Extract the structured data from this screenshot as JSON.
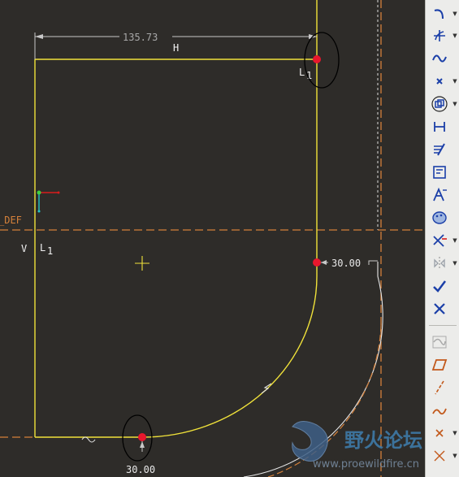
{
  "sketch": {
    "dimension_top": "135.73",
    "dimension_right": "30.00",
    "dimension_bottom": "30.00",
    "constraint_h": "H",
    "constraint_v": "V",
    "constraint_l1_top": "L",
    "constraint_l1_top_sub": "1",
    "constraint_l1_left": "L",
    "constraint_l1_left_sub": "1",
    "datum_label": "_DEF"
  },
  "colors": {
    "background": "#2e2c29",
    "sketch_line": "#f0e23a",
    "datum_line": "#d4803a",
    "dimension": "#c8c8c8",
    "point": "#e8172d",
    "toolbar_bg": "#ececea",
    "toolbar_icon": "#1b3fa8"
  },
  "toolbar": {
    "tools": [
      {
        "icon": "arc-icon",
        "has_menu": true
      },
      {
        "icon": "fillet-icon",
        "has_menu": true
      },
      {
        "icon": "spline-icon",
        "has_menu": false
      },
      {
        "icon": "point-icon",
        "has_menu": true
      },
      {
        "icon": "offset-edge-icon",
        "has_menu": true
      },
      {
        "icon": "dimension-icon",
        "has_menu": false
      },
      {
        "icon": "modify-icon",
        "has_menu": false
      },
      {
        "icon": "constraint-icon",
        "has_menu": false
      },
      {
        "icon": "text-icon",
        "has_menu": false
      },
      {
        "icon": "palette-icon",
        "has_menu": false
      },
      {
        "icon": "trim-icon",
        "has_menu": true
      },
      {
        "icon": "mirror-icon",
        "has_menu": true
      },
      {
        "icon": "done-icon",
        "has_menu": false
      },
      {
        "icon": "quit-icon",
        "has_menu": false
      },
      {
        "icon": "datum-curve-icon",
        "has_menu": false
      },
      {
        "icon": "datum-plane-icon",
        "has_menu": false
      },
      {
        "icon": "datum-axis-icon",
        "has_menu": false
      },
      {
        "icon": "sketched-curve-icon",
        "has_menu": false
      },
      {
        "icon": "datum-point-icon",
        "has_menu": false
      }
    ]
  },
  "watermark": {
    "text": "野火论坛",
    "url": "www.proewildfire.cn"
  }
}
